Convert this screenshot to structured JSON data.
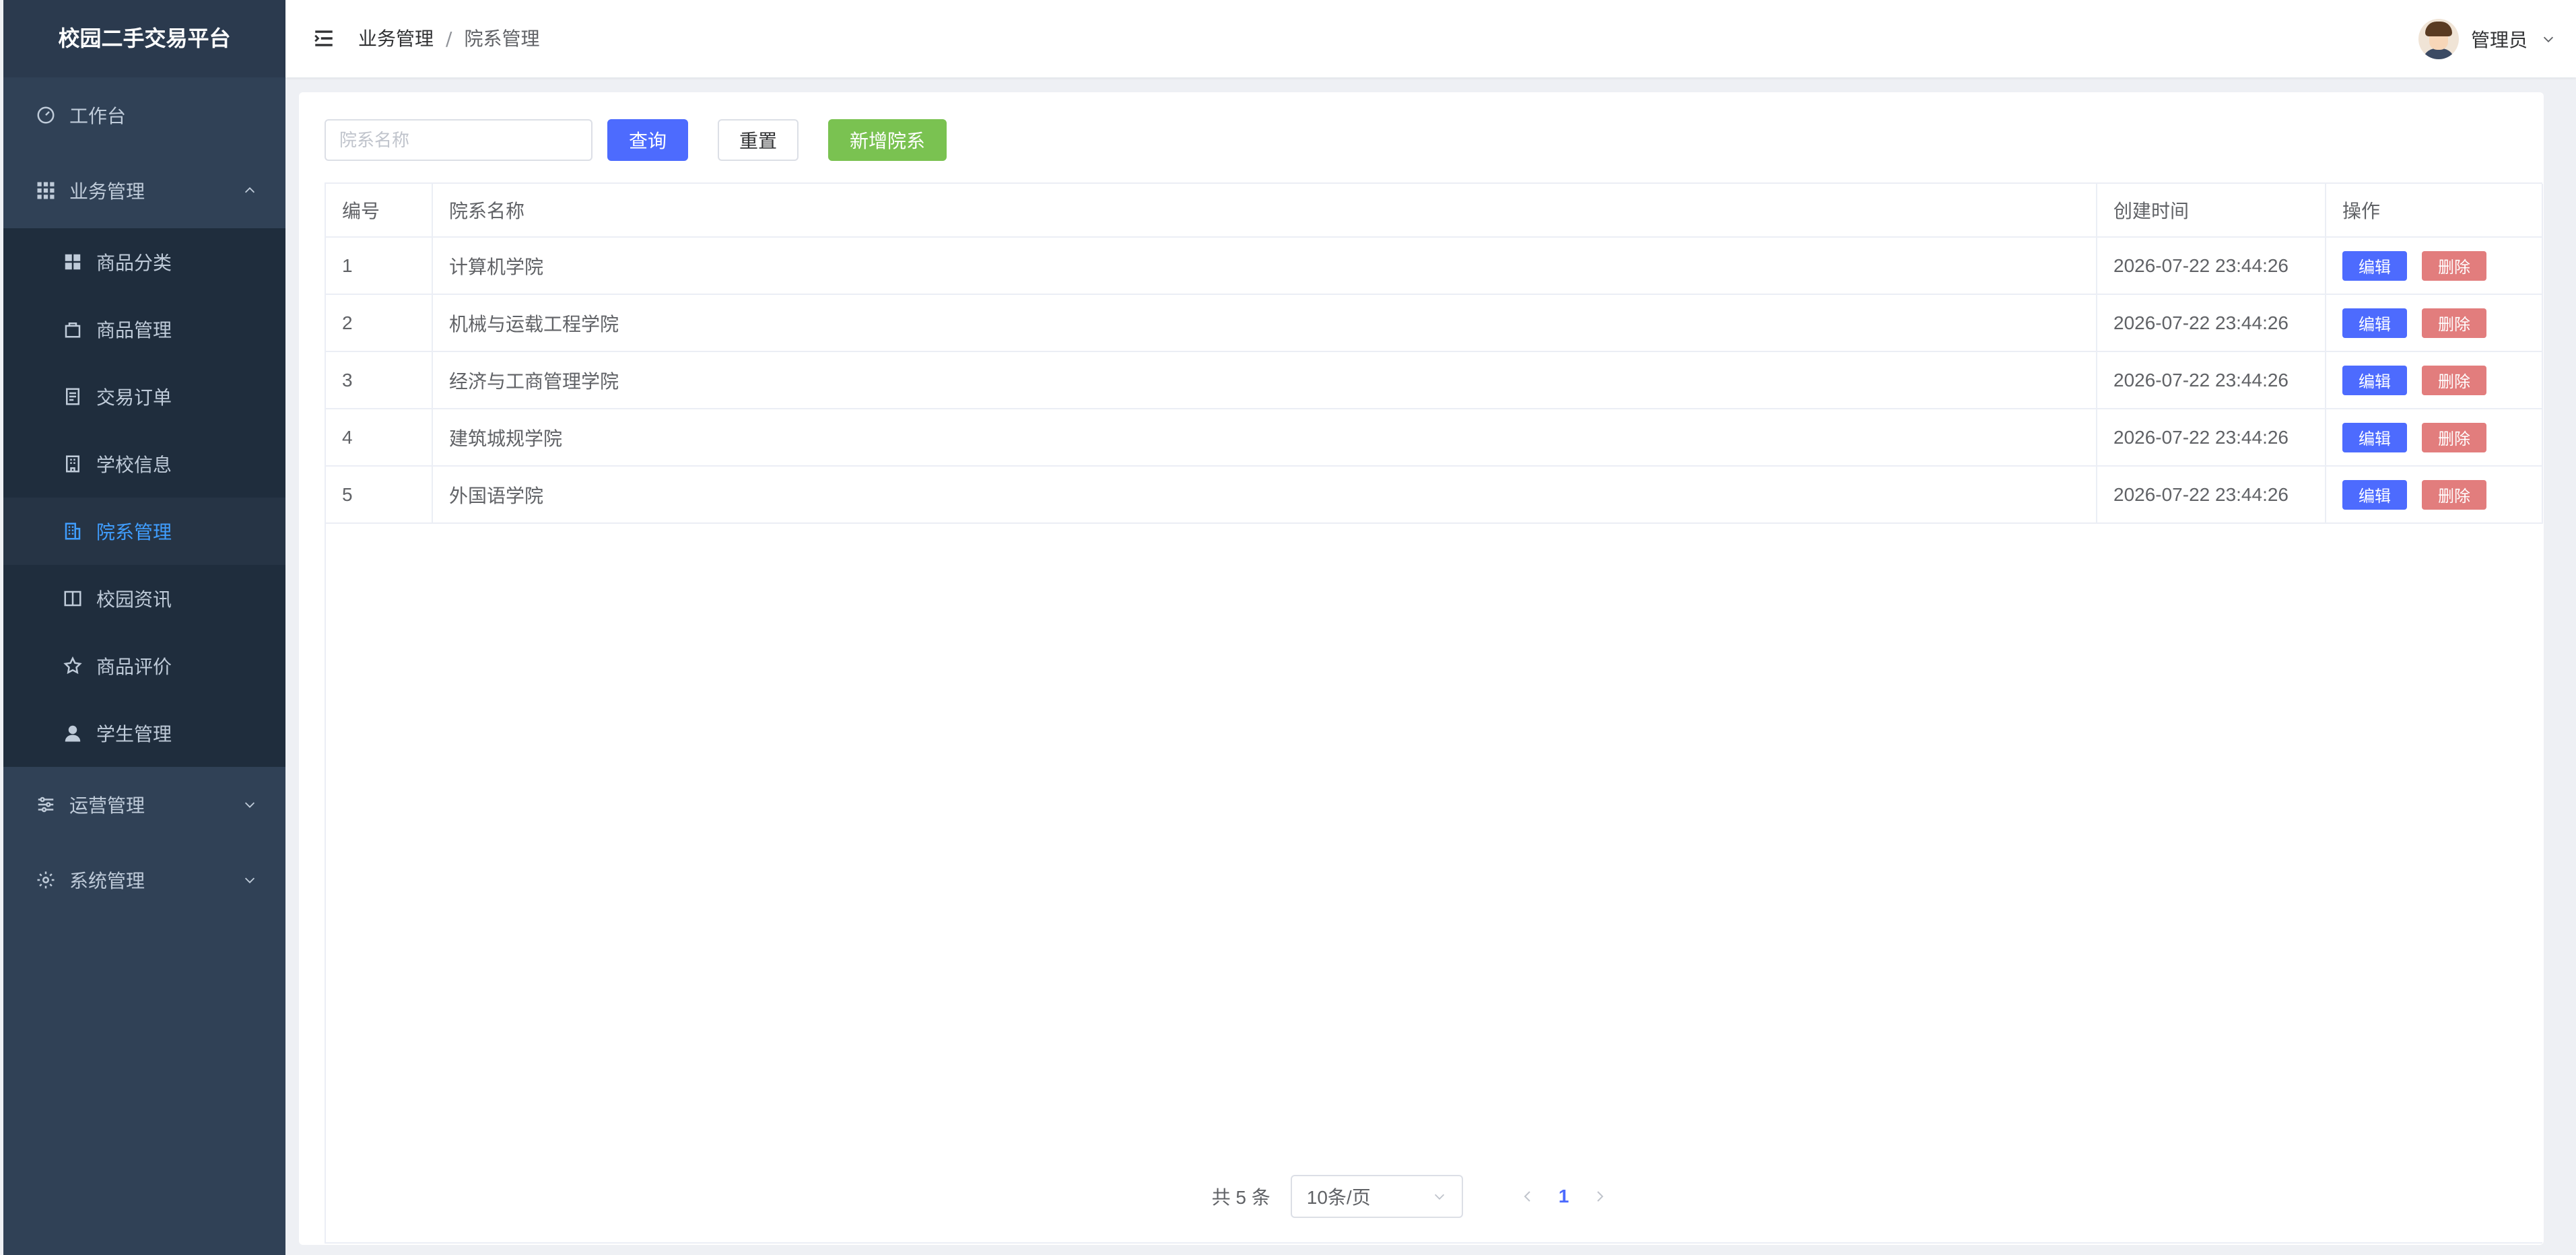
{
  "brand": "校园二手交易平台",
  "sidebar": {
    "items": [
      {
        "label": "工作台"
      },
      {
        "label": "业务管理"
      },
      {
        "label": "商品分类"
      },
      {
        "label": "商品管理"
      },
      {
        "label": "交易订单"
      },
      {
        "label": "学校信息"
      },
      {
        "label": "院系管理"
      },
      {
        "label": "校园资讯"
      },
      {
        "label": "商品评价"
      },
      {
        "label": "学生管理"
      },
      {
        "label": "运营管理"
      },
      {
        "label": "系统管理"
      }
    ],
    "active_color": "#409eff"
  },
  "header": {
    "breadcrumb_parent": "业务管理",
    "breadcrumb_sep": "/",
    "breadcrumb_current": "院系管理",
    "user_name": "管理员"
  },
  "toolbar": {
    "search_placeholder": "院系名称",
    "search_value": "",
    "query_label": "查询",
    "reset_label": "重置",
    "add_label": "新增院系"
  },
  "table": {
    "headers": [
      "编号",
      "院系名称",
      "创建时间",
      "操作"
    ],
    "rows": [
      {
        "id": "1",
        "name": "计算机学院",
        "created": "2026-07-22 23:44:26"
      },
      {
        "id": "2",
        "name": "机械与运载工程学院",
        "created": "2026-07-22 23:44:26"
      },
      {
        "id": "3",
        "name": "经济与工商管理学院",
        "created": "2026-07-22 23:44:26"
      },
      {
        "id": "4",
        "name": "建筑城规学院",
        "created": "2026-07-22 23:44:26"
      },
      {
        "id": "5",
        "name": "外国语学院",
        "created": "2026-07-22 23:44:26"
      }
    ],
    "edit_label": "编辑",
    "delete_label": "删除"
  },
  "pagination": {
    "total_text": "共 5 条",
    "page_size": "10条/页",
    "current_page": "1"
  },
  "colors": {
    "primary": "#4d6bfe",
    "success": "#7ac251",
    "danger": "#e27d7d",
    "sidebar_bg": "#304156"
  }
}
